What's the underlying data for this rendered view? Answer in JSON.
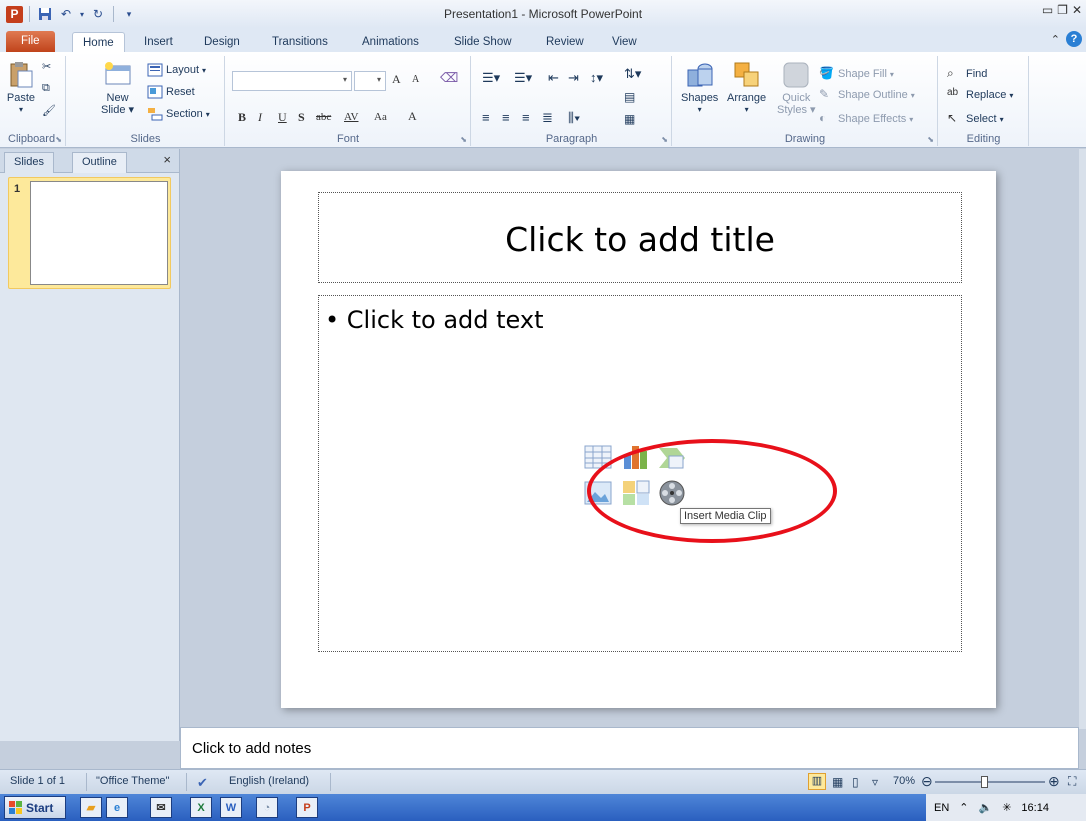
{
  "window": {
    "title": "Presentation1 - Microsoft PowerPoint",
    "app_icon_label": "P"
  },
  "tabs": [
    {
      "label": "File"
    },
    {
      "label": "Home"
    },
    {
      "label": "Insert"
    },
    {
      "label": "Design"
    },
    {
      "label": "Transitions"
    },
    {
      "label": "Animations"
    },
    {
      "label": "Slide Show"
    },
    {
      "label": "Review"
    },
    {
      "label": "View"
    }
  ],
  "ribbon": {
    "clipboard": {
      "label": "Clipboard",
      "paste": "Paste"
    },
    "slides": {
      "label": "Slides",
      "new_slide_line1": "New",
      "new_slide_line2": "Slide",
      "layout": "Layout",
      "reset": "Reset",
      "section": "Section"
    },
    "font": {
      "label": "Font",
      "bold": "B",
      "italic": "I",
      "underline": "U",
      "shadow": "S",
      "strike": "abc",
      "spacing": "AV",
      "case": "Aa",
      "color": "A",
      "grow": "A",
      "shrink": "A"
    },
    "paragraph": {
      "label": "Paragraph"
    },
    "drawing": {
      "label": "Drawing",
      "shapes": "Shapes",
      "arrange": "Arrange",
      "quick_styles_line1": "Quick",
      "quick_styles_line2": "Styles",
      "shape_fill": "Shape Fill",
      "shape_outline": "Shape Outline",
      "shape_effects": "Shape Effects"
    },
    "editing": {
      "label": "Editing",
      "find": "Find",
      "replace": "Replace",
      "select": "Select"
    }
  },
  "left_pane": {
    "tab_slides": "Slides",
    "tab_outline": "Outline",
    "close": "×",
    "slide_number": "1"
  },
  "slide": {
    "title_placeholder": "Click to add title",
    "body_placeholder": "• Click to add text",
    "tooltip": "Insert Media Clip"
  },
  "notes": {
    "placeholder": "Click to add notes"
  },
  "status": {
    "slide_info": "Slide 1 of 1",
    "theme": "\"Office Theme\"",
    "language": "English (Ireland)",
    "zoom": "70%",
    "zoom_fraction": 0.45
  },
  "taskbar": {
    "start": "Start",
    "language": "EN",
    "time": "16:14"
  },
  "colors": {
    "accent_file_tab": "#c0431b",
    "highlight_ellipse": "#e8101a",
    "selected_thumb": "#fde99b"
  }
}
